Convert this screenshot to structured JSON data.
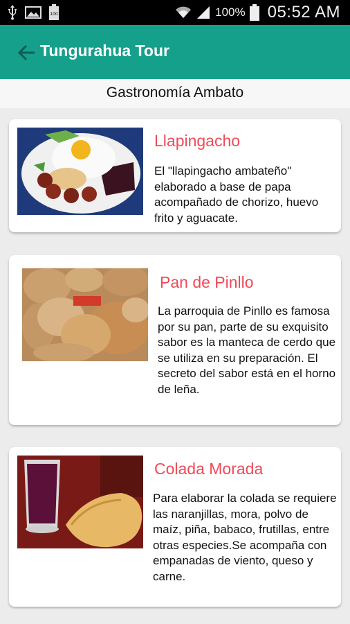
{
  "status_bar": {
    "battery_pct": "100%",
    "time": "05:52 AM",
    "notification_badge": "100",
    "icons": [
      "usb-icon",
      "image-icon",
      "battery-small-icon",
      "wifi-icon",
      "signal-icon",
      "battery-icon"
    ]
  },
  "app_bar": {
    "title": "Tungurahua Tour",
    "back_icon": "arrow-left-icon",
    "color": "#15a08c"
  },
  "section_title": "Gastronomía Ambato",
  "accent_color": "#f04a57",
  "dishes": [
    {
      "name": "Llapingacho",
      "description": "El \"llapingacho ambateño\" elaborado a base de papa acompañado de chorizo, huevo frito y aguacate."
    },
    {
      "name": "Pan de Pinllo",
      "description": "La parroquia de Pinllo es famosa por su pan, parte de su exquisito sabor es la manteca de cerdo que se utiliza en su preparación. El secreto del sabor está en el horno de leña."
    },
    {
      "name": "Colada Morada",
      "description": "Para elaborar la colada se requiere las naranjillas, mora, polvo de maíz, piña, babaco, frutillas, entre otras especies.Se acompaña con empanadas de viento, queso y carne."
    }
  ]
}
